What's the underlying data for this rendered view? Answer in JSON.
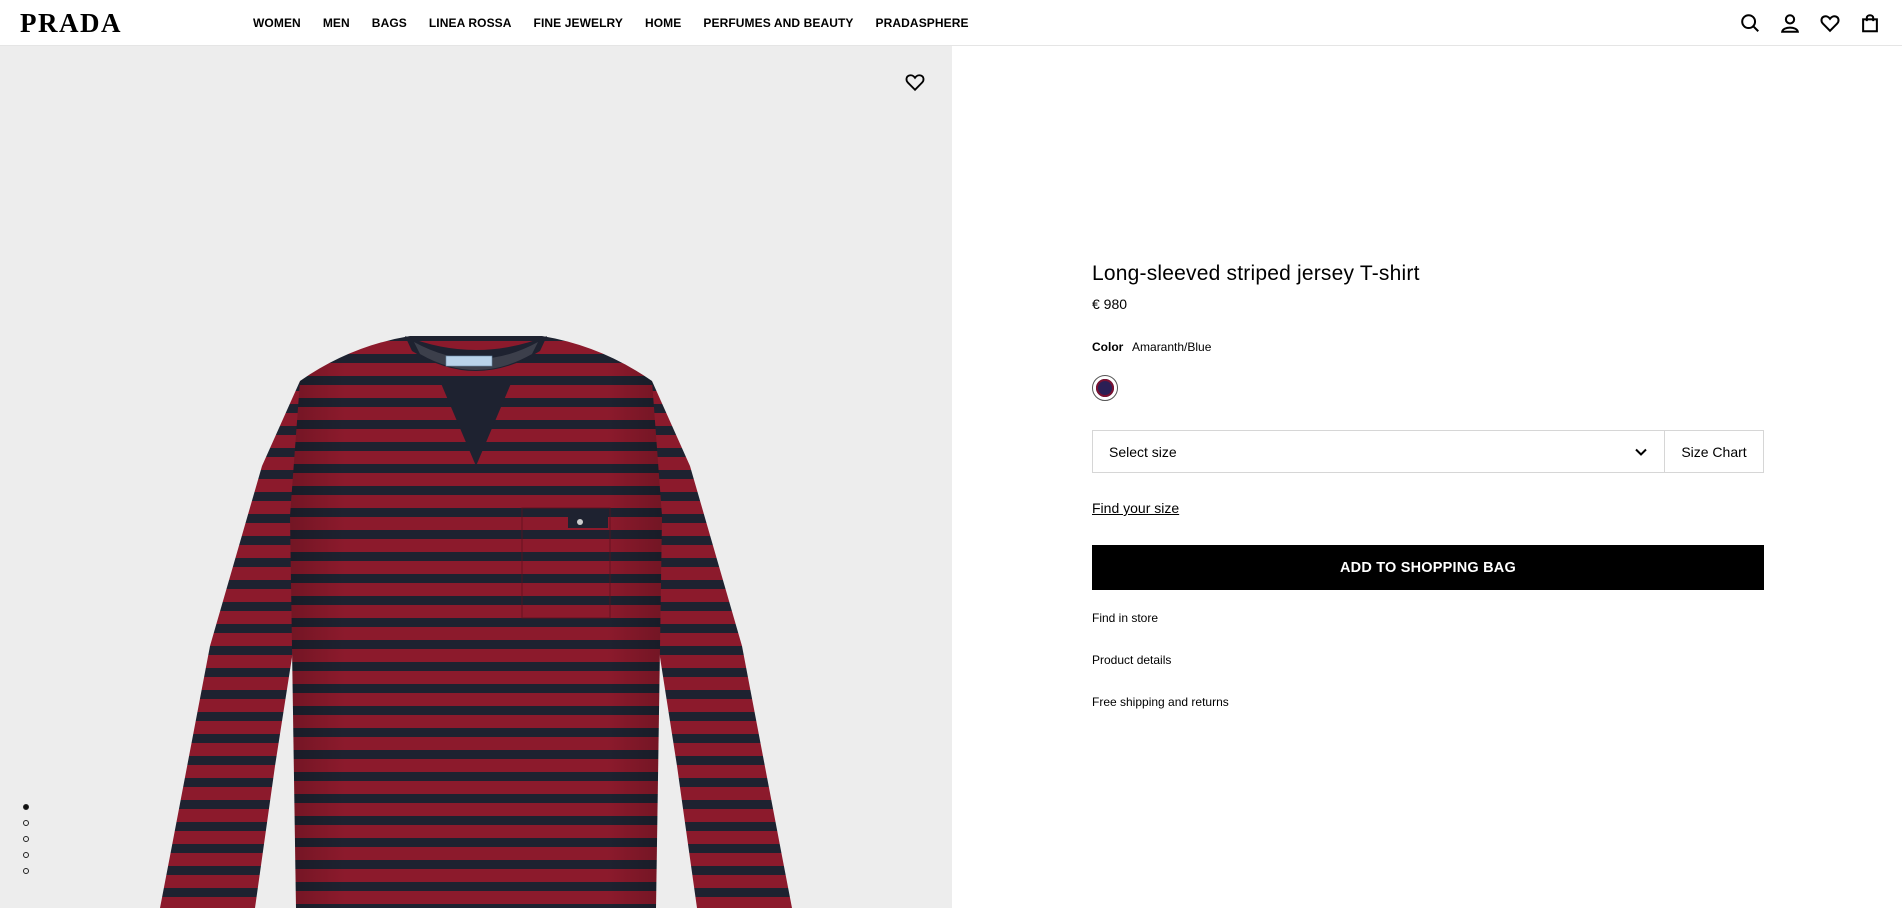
{
  "header": {
    "logo": "PRADA",
    "nav": [
      "WOMEN",
      "MEN",
      "BAGS",
      "LINEA ROSSA",
      "FINE JEWELRY",
      "HOME",
      "PERFUMES AND BEAUTY",
      "PRADASPHERE"
    ],
    "icons": [
      "search-icon",
      "account-icon",
      "wishlist-icon",
      "shopping-bag-icon"
    ]
  },
  "gallery": {
    "image_alt": "Long-sleeved striped jersey T-shirt",
    "image_count": 5,
    "active_index": 0
  },
  "product": {
    "title": "Long-sleeved striped jersey T-shirt",
    "price": "€ 980",
    "color_label": "Color",
    "color_value": "Amaranth/Blue",
    "size_placeholder": "Select size",
    "size_chart_label": "Size Chart",
    "find_size_label": "Find your size",
    "add_to_bag_label": "ADD TO SHOPPING BAG",
    "links": [
      "Find in store",
      "Product details",
      "Free shipping and returns"
    ]
  },
  "colors": {
    "stripe_red": "#8c1a2c",
    "stripe_navy": "#1e2230",
    "background": "#ededed",
    "button": "#000000"
  }
}
